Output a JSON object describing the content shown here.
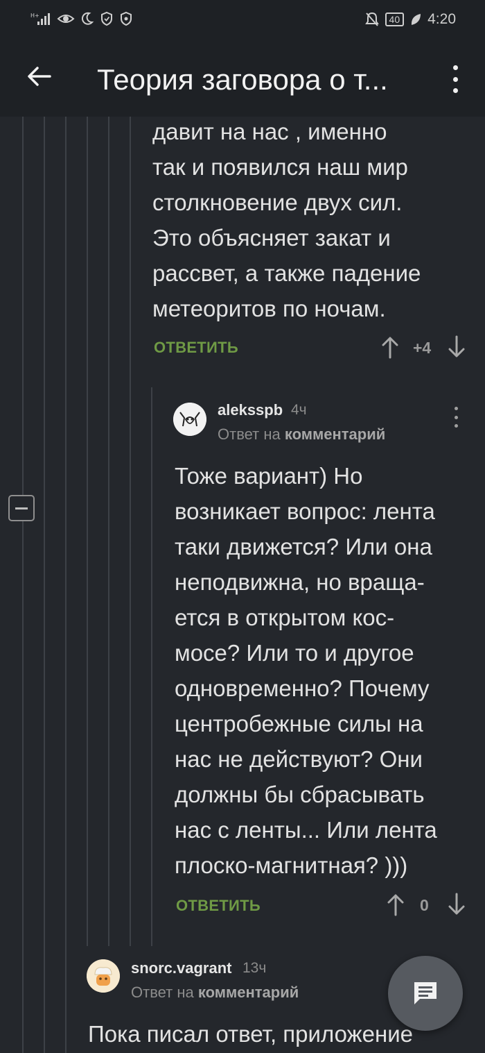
{
  "status_bar": {
    "time": "4:20",
    "battery": "40",
    "left_icons": [
      "signal-icon",
      "eye-icon",
      "moon-icon",
      "shield-icon",
      "shield-check-icon"
    ],
    "right_icons": [
      "bell-off-icon",
      "battery-icon",
      "leaf-icon"
    ]
  },
  "appbar": {
    "title": "Теория заговора о т..."
  },
  "comment_top": {
    "lines": [
      "давит на нас , именно",
      "так и появился наш мир",
      "столкновение двух сил.",
      "Это объясняет закат и",
      "рассвет, а также падение",
      "метеоритов по ночам."
    ],
    "reply_label": "ОТВЕТИТЬ",
    "votes": "+4"
  },
  "comment_alekss": {
    "username": "aleksspb",
    "time": "4ч",
    "answer_prefix": "Ответ на",
    "answer_target": "комментарий",
    "lines": [
      "Тоже вариант) Но",
      "возникает вопрос: лента",
      "таки движется? Или она",
      "неподвижна, но враща-",
      "ется в открытом кос-",
      "мосе? Или то и другое",
      "одновременно? Почему",
      "центробежные силы на",
      "нас не действуют? Они",
      "должны бы сбрасывать",
      "нас с ленты... Или лента",
      "плоско-магнитная? )))"
    ],
    "reply_label": "ОТВЕТИТЬ",
    "votes": "0"
  },
  "comment_snorc": {
    "username": "snorc.vagrant",
    "time": "13ч",
    "answer_prefix": "Ответ на",
    "answer_target": "комментарий",
    "lines": [
      "Пока писал ответ, приложение"
    ]
  },
  "colors": {
    "background": "#24272c",
    "bar": "#1e2125",
    "accent_green": "#6f9a45",
    "thread_line": "#3d4147",
    "fab": "#565a60"
  }
}
